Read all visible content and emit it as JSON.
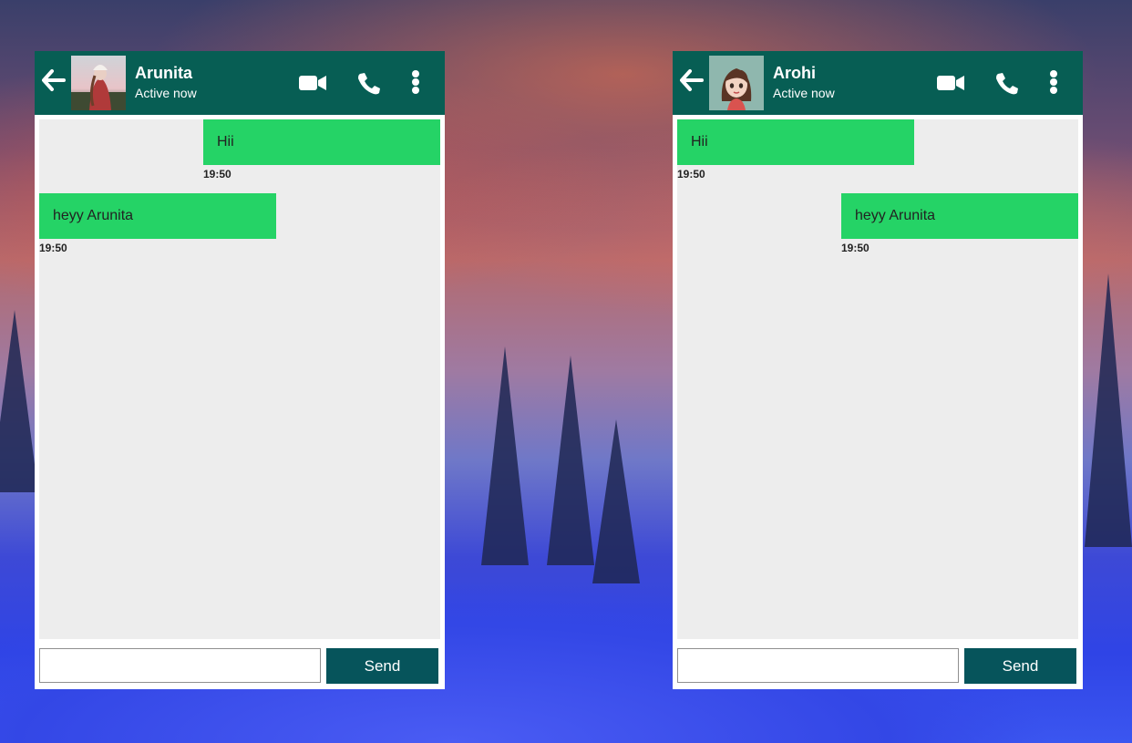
{
  "colors": {
    "header_bg": "#075e54",
    "bubble_bg": "#25d366",
    "messages_bg": "#ededed",
    "send_bg": "#06545b"
  },
  "chats": [
    {
      "contact": {
        "name": "Arunita",
        "status": "Active now",
        "avatar_icon": "photo-avatar"
      },
      "header_icons": [
        "back-arrow-icon",
        "video-camera-icon",
        "phone-icon",
        "more-vertical-icon"
      ],
      "messages": [
        {
          "text": "Hii",
          "time": "19:50",
          "side": "right"
        },
        {
          "text": "heyy Arunita",
          "time": "19:50",
          "side": "left"
        }
      ],
      "input": {
        "value": "",
        "placeholder": ""
      },
      "send_label": "Send"
    },
    {
      "contact": {
        "name": "Arohi",
        "status": "Active now",
        "avatar_icon": "cartoon-girl-avatar"
      },
      "header_icons": [
        "back-arrow-icon",
        "video-camera-icon",
        "phone-icon",
        "more-vertical-icon"
      ],
      "messages": [
        {
          "text": "Hii",
          "time": "19:50",
          "side": "left"
        },
        {
          "text": "heyy Arunita",
          "time": "19:50",
          "side": "right"
        }
      ],
      "input": {
        "value": "",
        "placeholder": ""
      },
      "send_label": "Send"
    }
  ]
}
